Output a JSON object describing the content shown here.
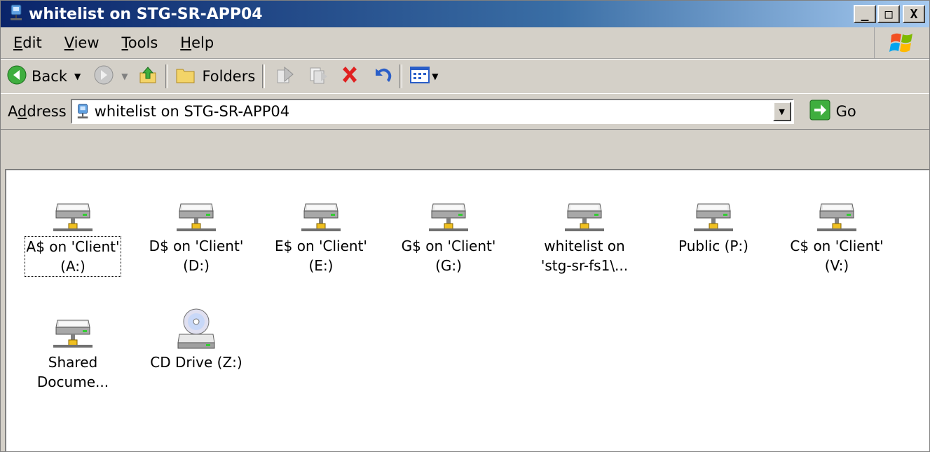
{
  "window": {
    "title": "whitelist on STG-SR-APP04",
    "controls": {
      "minimize": "_",
      "maximize": "□",
      "close": "X"
    }
  },
  "menu": {
    "items": [
      {
        "label": "Edit",
        "accel": "E",
        "rest": "dit"
      },
      {
        "label": "View",
        "accel": "V",
        "rest": "iew"
      },
      {
        "label": "Tools",
        "accel": "T",
        "rest": "ools"
      },
      {
        "label": "Help",
        "accel": "H",
        "rest": "elp"
      }
    ]
  },
  "toolbar": {
    "back_label": "Back",
    "folders_label": "Folders"
  },
  "address": {
    "label_pre": "A",
    "label_accel": "d",
    "label_post": "dress",
    "value": "whitelist on STG-SR-APP04",
    "go_label": "Go"
  },
  "items": [
    {
      "line1": "A$ on 'Client'",
      "line2": "(A:)",
      "icon": "network-drive-icon"
    },
    {
      "line1": "D$ on 'Client'",
      "line2": "(D:)",
      "icon": "network-drive-icon"
    },
    {
      "line1": "E$ on 'Client'",
      "line2": "(E:)",
      "icon": "network-drive-icon"
    },
    {
      "line1": "G$ on 'Client'",
      "line2": "(G:)",
      "icon": "network-drive-icon"
    },
    {
      "line1": "whitelist on",
      "line2": "'stg-sr-fs1\\...",
      "icon": "network-drive-icon"
    },
    {
      "line1": "Public (P:)",
      "line2": "",
      "icon": "network-drive-icon"
    },
    {
      "line1": "C$ on 'Client'",
      "line2": "(V:)",
      "icon": "network-drive-icon"
    },
    {
      "line1": "Shared",
      "line2": "Docume...",
      "icon": "network-drive-icon"
    },
    {
      "line1": "CD Drive (Z:)",
      "line2": "",
      "icon": "cd-drive-icon"
    }
  ],
  "colors": {
    "titlebar_start": "#0a246a",
    "titlebar_end": "#a6caf0",
    "chrome": "#d4d0c8"
  }
}
